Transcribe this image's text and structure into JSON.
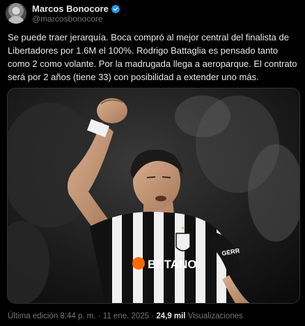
{
  "author": {
    "display_name": "Marcos Bonocore",
    "handle": "@marcosbonocore",
    "verified": true,
    "verified_color": "#1d9bf0"
  },
  "tweet": {
    "text": "Se puede traer jerarquía. Boca compró al mejor central del finalista de Libertadores por 1.6M el 100%. Rodrigo Battaglia es pensado tanto como 2 como volante. Por la madrugada llega a aeroparque. El contrato será por 2 años (tiene 33) con posibilidad a extender uno más."
  },
  "media": {
    "shirt_sponsor": "BETANO",
    "shirt_sleeve_text": "GERR"
  },
  "meta": {
    "edited_timestamp": "Última edición 8:44 p. m. · 11 ene. 2025",
    "separator": " · ",
    "views_count": "24,9 mil",
    "views_label": "Visualizaciones"
  },
  "colors": {
    "background": "#000000",
    "text_primary": "#e7e9ea",
    "text_secondary": "#71767b",
    "border": "#2f3336"
  }
}
